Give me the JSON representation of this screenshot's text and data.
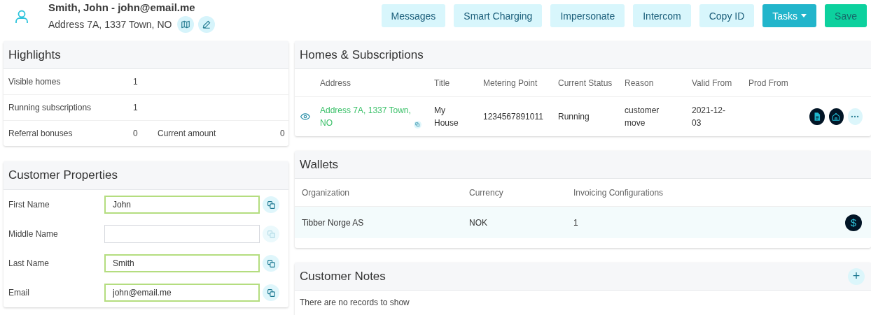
{
  "header": {
    "name": "Smith, John - john@email.me",
    "address": "Address 7A, 1337 Town, NO",
    "buttons": [
      {
        "label": "Messages",
        "kind": "light"
      },
      {
        "label": "Smart Charging",
        "kind": "light"
      },
      {
        "label": "Impersonate",
        "kind": "light"
      },
      {
        "label": "Intercom",
        "kind": "light"
      },
      {
        "label": "Copy ID",
        "kind": "light"
      },
      {
        "label": "Tasks",
        "kind": "dropdown"
      },
      {
        "label": "Save",
        "kind": "save"
      }
    ]
  },
  "highlights": {
    "title": "Highlights",
    "rows": [
      {
        "label": "Visible homes",
        "value": "1"
      },
      {
        "label": "Running subscriptions",
        "value": "1"
      },
      {
        "label": "Referral bonuses",
        "value": "0",
        "extra_label": "Current amount",
        "extra_value": "0"
      }
    ]
  },
  "customer_properties": {
    "title": "Customer Properties",
    "fields": [
      {
        "label": "First Name",
        "value": "John",
        "valid": true
      },
      {
        "label": "Middle Name",
        "valid": false
      },
      {
        "label": "Last Name",
        "value": "Smith",
        "valid": true
      },
      {
        "label": "Email",
        "value": "john@email.me",
        "valid": true
      }
    ]
  },
  "homes": {
    "title": "Homes & Subscriptions",
    "columns": [
      "Address",
      "Title",
      "Metering Point",
      "Current Status",
      "Reason",
      "Valid From",
      "Prod From"
    ],
    "rows": [
      {
        "address": "Address 7A, 1337 Town, NO",
        "title": "My House",
        "metering_point": "1234567891011",
        "status": "Running",
        "reason": "customer move",
        "valid_from": "2021-12-03"
      }
    ]
  },
  "wallets": {
    "title": "Wallets",
    "columns": [
      "Organization",
      "Currency",
      "Invoicing Configurations"
    ],
    "rows": [
      {
        "organization": "Tibber Norge AS",
        "currency": "NOK",
        "configurations": "1",
        "highlighted": true,
        "action_symbol": "$"
      }
    ]
  },
  "notes": {
    "title": "Customer Notes",
    "add_symbol": "+",
    "empty_text": "There are no records to show"
  }
}
